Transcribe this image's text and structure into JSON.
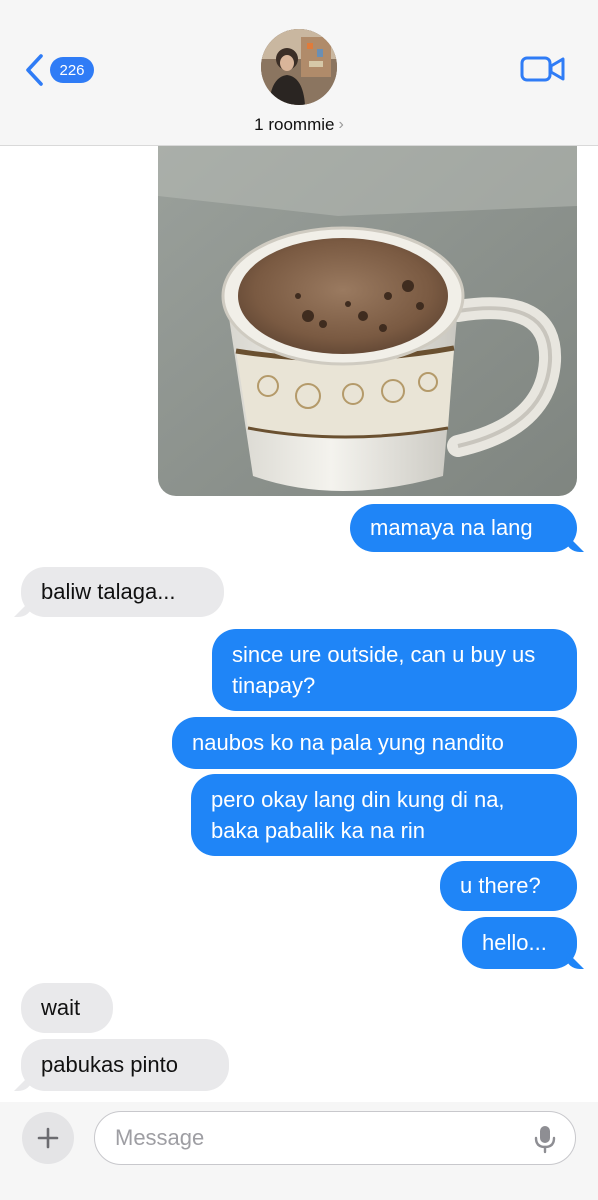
{
  "header": {
    "back_badge": "226",
    "contact_name": "1 roommie",
    "name_chevron": "›",
    "back_icon": "chevron-left-icon",
    "video_icon": "video-camera-icon"
  },
  "colors": {
    "accent": "#2f7cf6",
    "outgoing_bubble": "#1f85f7",
    "incoming_bubble": "#e9e9eb"
  },
  "messages": [
    {
      "from": "me",
      "type": "image",
      "description_icon": "photo-attachment"
    },
    {
      "from": "me",
      "text": "mamaya na lang"
    },
    {
      "from": "them",
      "text": "baliw talaga..."
    },
    {
      "from": "me",
      "text": "since ure outside, can u buy us tinapay?"
    },
    {
      "from": "me",
      "text": "naubos ko na pala yung nandito"
    },
    {
      "from": "me",
      "text": "pero okay lang din kung di na, baka pabalik ka na rin"
    },
    {
      "from": "me",
      "text": "u there?"
    },
    {
      "from": "me",
      "text": "hello..."
    },
    {
      "from": "them",
      "text": "wait"
    },
    {
      "from": "them",
      "text": "pabukas pinto"
    }
  ],
  "composer": {
    "placeholder": "Message",
    "value": "",
    "plus_label": "+",
    "mic_icon": "microphone-icon"
  }
}
